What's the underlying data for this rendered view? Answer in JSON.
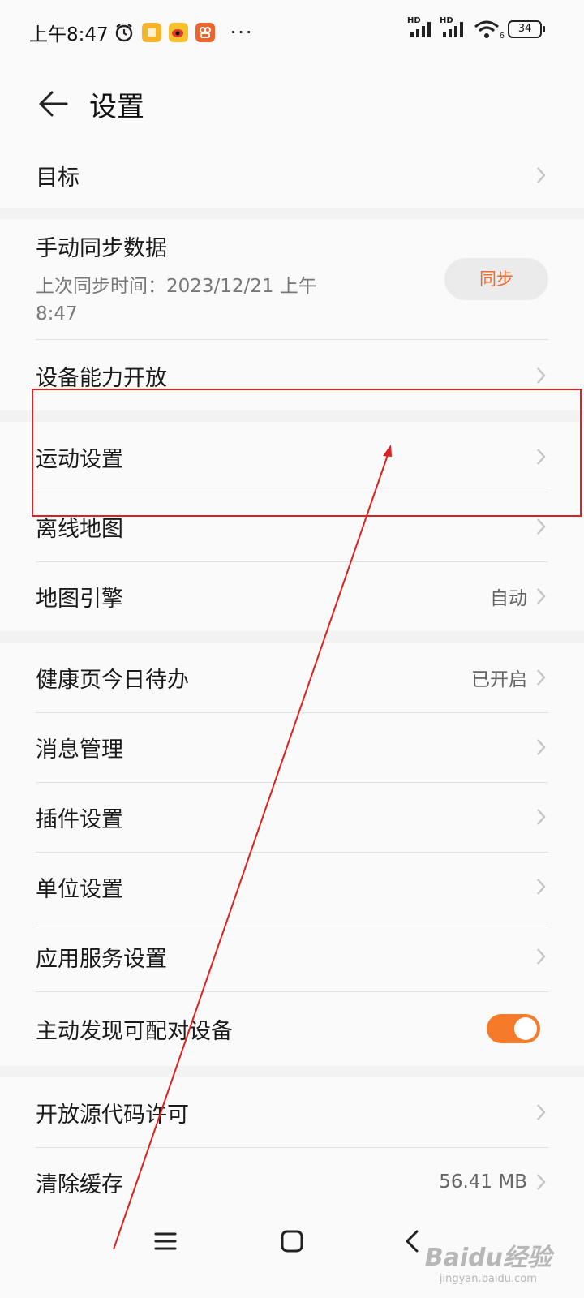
{
  "status_bar": {
    "time": "上午8:47",
    "battery": "34",
    "net1": "HD",
    "net2": "HD",
    "wifi_sub": "6",
    "more": "···",
    "app_icons": [
      {
        "name": "alarm-icon"
      },
      {
        "name": "notes-app-icon",
        "color": "#f6b42c"
      },
      {
        "name": "weibo-app-icon",
        "color": "#f6c12c"
      },
      {
        "name": "kuaishou-app-icon",
        "color": "#f2632b"
      }
    ]
  },
  "header": {
    "title": "设置"
  },
  "sections": {
    "goal": {
      "label": "目标"
    },
    "sync": {
      "title": "手动同步数据",
      "subtitle_line1": "上次同步时间：2023/12/21 上午",
      "subtitle_line2": "8:47",
      "button": "同步"
    },
    "device_capability": {
      "label": "设备能力开放"
    },
    "sport_settings": {
      "label": "运动设置"
    },
    "offline_map": {
      "label": "离线地图"
    },
    "map_engine": {
      "label": "地图引擎",
      "value": "自动"
    },
    "health_todo": {
      "label": "健康页今日待办",
      "value": "已开启"
    },
    "message_mgmt": {
      "label": "消息管理"
    },
    "plugin_settings": {
      "label": "插件设置"
    },
    "unit_settings": {
      "label": "单位设置"
    },
    "app_service": {
      "label": "应用服务设置"
    },
    "discover_devices": {
      "label": "主动发现可配对设备",
      "toggle_on": true
    },
    "open_source": {
      "label": "开放源代码许可"
    },
    "clear_cache": {
      "label": "清除缓存",
      "value": "56.41 MB"
    }
  },
  "watermark": {
    "logo": "Baidu经验",
    "url": "jingyan.baidu.com"
  },
  "colors": {
    "accent": "#f57a2a",
    "annotation": "#e02020",
    "background": "#f2f2f2",
    "card": "#fafafa"
  }
}
